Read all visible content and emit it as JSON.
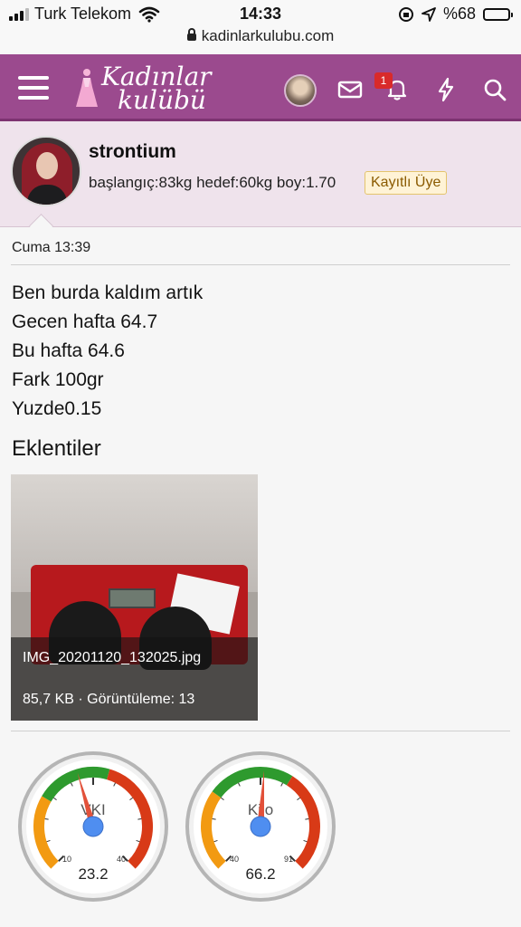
{
  "status_bar": {
    "carrier": "Turk Telekom",
    "time": "14:33",
    "battery": "%68",
    "battery_level": 0.68,
    "url": "kadinlarkulubu.com"
  },
  "header": {
    "logo_line1": "Kadınlar",
    "logo_line2": "kulübü",
    "notification_count": "1"
  },
  "user": {
    "name": "strontium",
    "stats": "başlangıç:83kg hedef:60kg boy:1.70",
    "role_badge": "Kayıtlı Üye"
  },
  "post": {
    "date": "Cuma 13:39",
    "lines": [
      "Ben burda kaldım artık",
      "Gecen hafta 64.7",
      "Bu hafta 64.6",
      "Fark 100gr",
      "Yuzde0.15"
    ]
  },
  "attachments": {
    "title": "Eklentiler",
    "items": [
      {
        "filename": "IMG_20201120_132025.jpg",
        "meta": "85,7 KB · Görüntüleme: 13"
      }
    ]
  },
  "gauges": [
    {
      "label": "VKI",
      "value": "23.2",
      "min": "10",
      "max": "40",
      "value_num": 23.2,
      "min_num": 10,
      "max_num": 40
    },
    {
      "label": "Kilo",
      "value": "66.2",
      "min": "40",
      "max": "91",
      "value_num": 66.2,
      "min_num": 40,
      "max_num": 91
    }
  ],
  "colors": {
    "header_bg": "#9b4a8e",
    "profile_bg": "#efe3ec",
    "gauge_green": "#2e9a2e",
    "gauge_orange": "#f29a12",
    "gauge_red": "#d83a17",
    "needle": "#e2513a",
    "hub": "#4f8ef0"
  }
}
